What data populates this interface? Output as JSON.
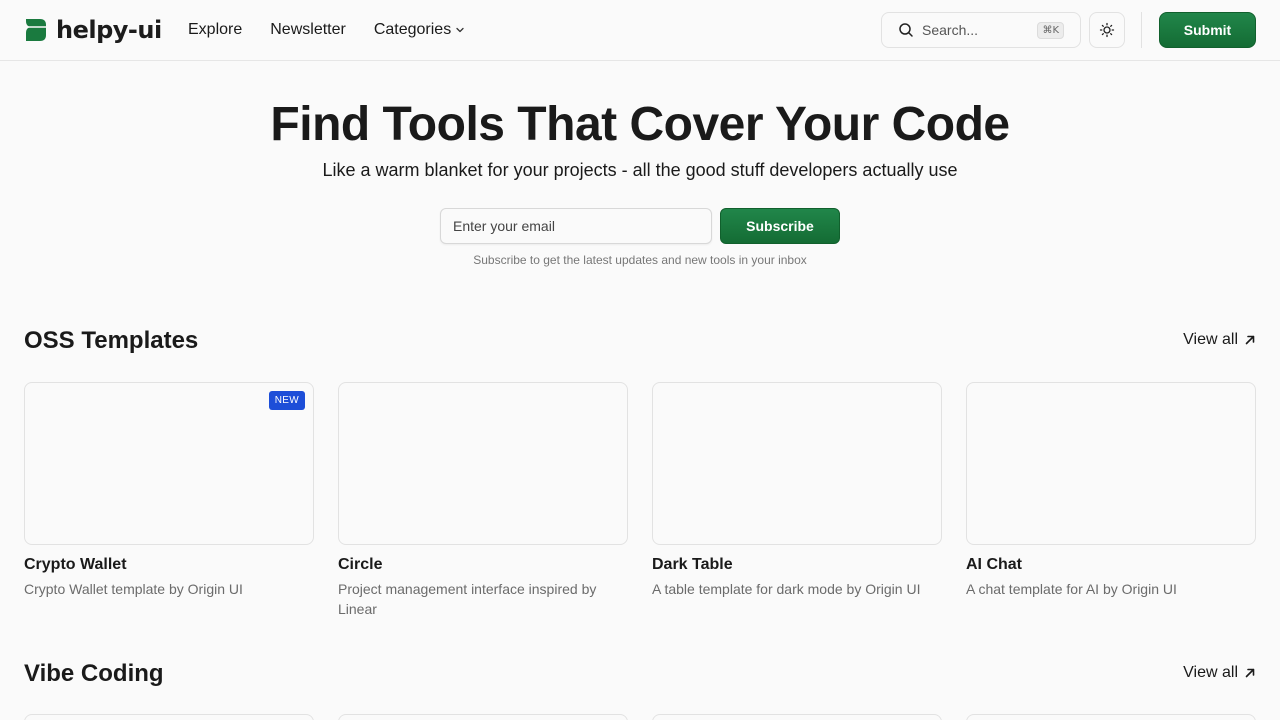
{
  "header": {
    "logo_text": "helpy-ui",
    "nav": [
      {
        "label": "Explore"
      },
      {
        "label": "Newsletter"
      },
      {
        "label": "Categories"
      }
    ],
    "search_placeholder": "Search...",
    "search_shortcut": "⌘K",
    "submit_label": "Submit"
  },
  "hero": {
    "title": "Find Tools That Cover Your Code",
    "subtitle": "Like a warm blanket for your projects - all the good stuff developers actually use",
    "email_placeholder": "Enter your email",
    "subscribe_label": "Subscribe",
    "note": "Subscribe to get the latest updates and new tools in your inbox"
  },
  "sections": [
    {
      "title": "OSS Templates",
      "view_all": "View all",
      "cards": [
        {
          "title": "Crypto Wallet",
          "desc": "Crypto Wallet template by Origin UI",
          "badge": "NEW"
        },
        {
          "title": "Circle",
          "desc": "Project management interface inspired by Linear"
        },
        {
          "title": "Dark Table",
          "desc": "A table template for dark mode by Origin UI"
        },
        {
          "title": "AI Chat",
          "desc": "A chat template for AI by Origin UI"
        }
      ]
    },
    {
      "title": "Vibe Coding",
      "view_all": "View all"
    }
  ],
  "colors": {
    "accent_green": "#1a7a3f",
    "badge_blue": "#1d4ed8"
  }
}
